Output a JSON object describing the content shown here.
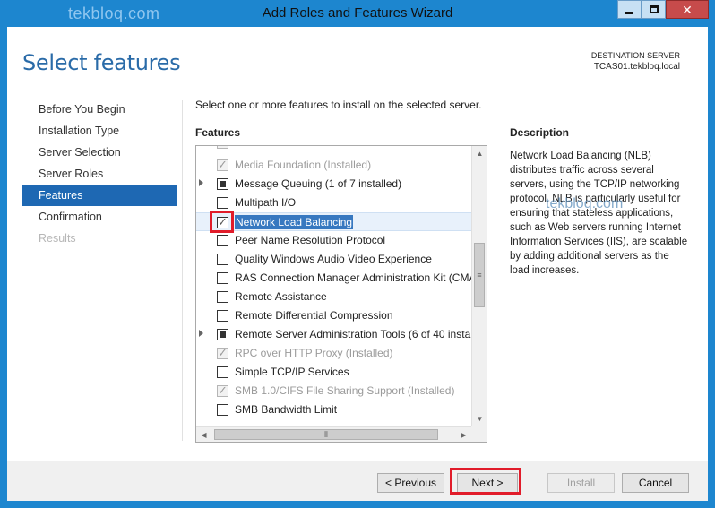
{
  "window": {
    "title": "Add Roles and Features Wizard",
    "watermark_top": "tekbloq.com",
    "watermark_mid": "tekbloq.com",
    "controls": {
      "minimize": "",
      "maximize": "",
      "close": "✕"
    }
  },
  "header": {
    "page_title": "Select features",
    "destination_label": "DESTINATION SERVER",
    "destination_server": "TCAS01.tekbloq.local"
  },
  "nav": {
    "items": [
      {
        "label": "Before You Begin",
        "state": "normal"
      },
      {
        "label": "Installation Type",
        "state": "normal"
      },
      {
        "label": "Server Selection",
        "state": "normal"
      },
      {
        "label": "Server Roles",
        "state": "normal"
      },
      {
        "label": "Features",
        "state": "active"
      },
      {
        "label": "Confirmation",
        "state": "normal"
      },
      {
        "label": "Results",
        "state": "disabled"
      }
    ]
  },
  "main": {
    "instruction": "Select one or more features to install on the selected server.",
    "features_label": "Features",
    "features": [
      {
        "label": "Media Foundation (Installed)",
        "checked": true,
        "installed": true,
        "expandable": false
      },
      {
        "label": "Message Queuing (1 of 7 installed)",
        "checked": "partial",
        "installed": false,
        "expandable": true
      },
      {
        "label": "Multipath I/O",
        "checked": false,
        "installed": false,
        "expandable": false
      },
      {
        "label": "Network Load Balancing",
        "checked": true,
        "installed": false,
        "expandable": false,
        "selected": true
      },
      {
        "label": "Peer Name Resolution Protocol",
        "checked": false,
        "installed": false,
        "expandable": false
      },
      {
        "label": "Quality Windows Audio Video Experience",
        "checked": false,
        "installed": false,
        "expandable": false
      },
      {
        "label": "RAS Connection Manager Administration Kit (CMA",
        "checked": false,
        "installed": false,
        "expandable": false
      },
      {
        "label": "Remote Assistance",
        "checked": false,
        "installed": false,
        "expandable": false
      },
      {
        "label": "Remote Differential Compression",
        "checked": false,
        "installed": false,
        "expandable": false
      },
      {
        "label": "Remote Server Administration Tools (6 of 40 instal",
        "checked": "partial",
        "installed": false,
        "expandable": true
      },
      {
        "label": "RPC over HTTP Proxy (Installed)",
        "checked": true,
        "installed": true,
        "expandable": false
      },
      {
        "label": "Simple TCP/IP Services",
        "checked": false,
        "installed": false,
        "expandable": false
      },
      {
        "label": "SMB 1.0/CIFS File Sharing Support (Installed)",
        "checked": true,
        "installed": true,
        "expandable": false
      },
      {
        "label": "SMB Bandwidth Limit",
        "checked": false,
        "installed": false,
        "expandable": false
      }
    ],
    "description_label": "Description",
    "description_text": "Network Load Balancing (NLB) distributes traffic across several servers, using the TCP/IP networking protocol. NLB is particularly useful for ensuring that stateless applications, such as Web servers running Internet Information Services (IIS), are scalable by adding additional servers as the load increases."
  },
  "footer": {
    "previous_label": "< Previous",
    "next_label": "Next >",
    "install_label": "Install",
    "cancel_label": "Cancel"
  },
  "colors": {
    "frame": "#1d86cf",
    "accent": "#1e68b3",
    "highlight_box": "#e11c2a"
  }
}
